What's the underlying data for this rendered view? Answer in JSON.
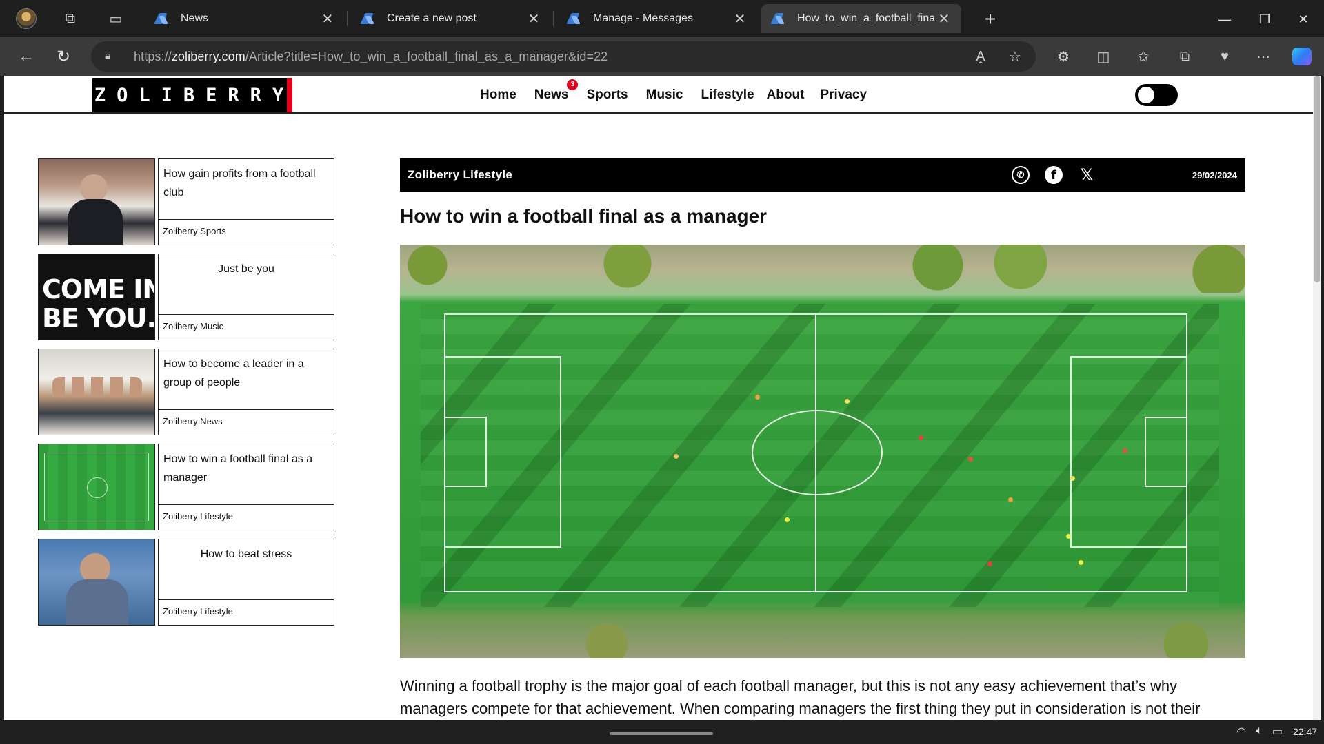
{
  "browser": {
    "tabs": [
      {
        "title": "News"
      },
      {
        "title": "Create a new post"
      },
      {
        "title": "Manage - Messages"
      },
      {
        "title": "How_to_win_a_football_fina"
      }
    ],
    "url_domain": "zoliberry.com",
    "url_prefix": "https://",
    "url_path": "/Article?title=How_to_win_a_football_final_as_a_manager&id=22"
  },
  "site": {
    "logo": "ZOLIBERRY",
    "menu": [
      "Home",
      "News",
      "Sports",
      "Music",
      "Lifestyle",
      "About",
      "Privacy"
    ],
    "news_badge": "3"
  },
  "sidebar": {
    "cards": [
      {
        "title": "How gain profits from a football club",
        "category": "Zoliberry Sports"
      },
      {
        "title": "Just be you",
        "category": "Zoliberry Music",
        "thumb_text": "COME IN.\nBE YOU."
      },
      {
        "title": "How to become a leader in a group of people",
        "category": "Zoliberry News"
      },
      {
        "title": "How to win a football final as a manager",
        "category": "Zoliberry Lifestyle"
      },
      {
        "title": "How to beat stress",
        "category": "Zoliberry Lifestyle"
      }
    ]
  },
  "article": {
    "category": "Zoliberry Lifestyle",
    "date": "29/02/2024",
    "title": "How to win a football final as a manager",
    "body": "Winning a football trophy is the major goal of each football manager, but this is not any easy achievement that’s why managers compete for that achievement. When comparing managers the first thing they put in consideration is not their"
  },
  "taskbar": {
    "time": "22:47"
  },
  "colors": {
    "brand_red": "#e3001b",
    "chrome_dark": "#1f1f1f",
    "chrome_toolbar": "#3a3a3a"
  }
}
